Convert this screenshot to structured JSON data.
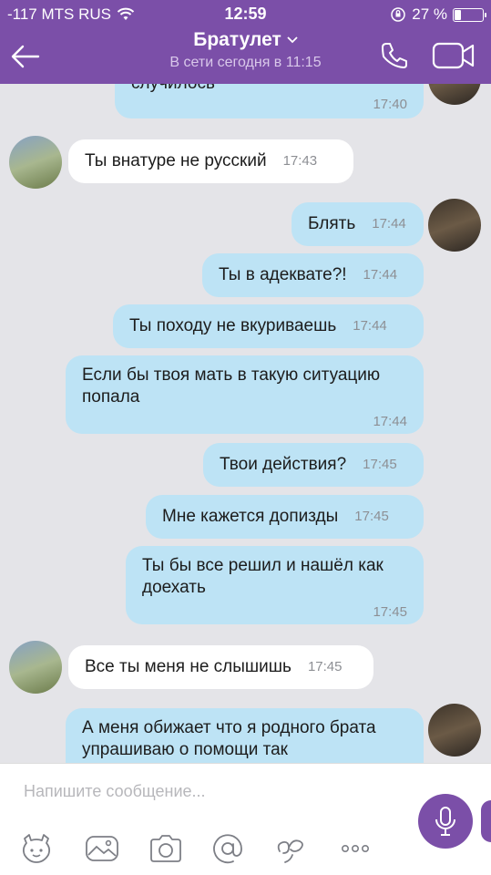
{
  "status_bar": {
    "carrier": "-117 MTS RUS",
    "time": "12:59",
    "battery_percent": "27 %",
    "battery_level": 0.27
  },
  "header": {
    "contact_name": "Братулет",
    "presence": "В сети сегодня в 11:15"
  },
  "messages": [
    {
      "direction": "out",
      "text": "случилось",
      "time": "17:40"
    },
    {
      "direction": "in",
      "text": "Ты внатуре не русский",
      "time": "17:43"
    },
    {
      "direction": "out",
      "text": "Блять",
      "time": "17:44"
    },
    {
      "direction": "out",
      "text": "Ты в адеквате?!",
      "time": "17:44"
    },
    {
      "direction": "out",
      "text": "Ты походу не вкуриваешь",
      "time": "17:44"
    },
    {
      "direction": "out",
      "text": "Если бы твоя мать в такую ситуацию попала",
      "time": "17:44"
    },
    {
      "direction": "out",
      "text": "Твои действия?",
      "time": "17:45"
    },
    {
      "direction": "out",
      "text": "Мне кажется допизды",
      "time": "17:45"
    },
    {
      "direction": "out",
      "text": "Ты бы все решил и нашёл как доехать",
      "time": "17:45"
    },
    {
      "direction": "in",
      "text": "Все ты меня не слышишь",
      "time": "17:45"
    },
    {
      "direction": "out",
      "text": "А меня обижает что я родного брата упрашиваю о помощи так",
      "time": ""
    }
  ],
  "composer": {
    "placeholder": "Напишите сообщение..."
  },
  "colors": {
    "header": "#7b4fa8",
    "outgoing_bubble": "#bde3f5",
    "incoming_bubble": "#ffffff",
    "chat_background": "#e4e4e8"
  },
  "icons": [
    "back-arrow-icon",
    "chevron-down-icon",
    "phone-icon",
    "video-camera-icon",
    "microphone-icon",
    "sticker-icon",
    "gallery-icon",
    "camera-icon",
    "at-sign-icon",
    "doodle-icon",
    "more-icon"
  ]
}
